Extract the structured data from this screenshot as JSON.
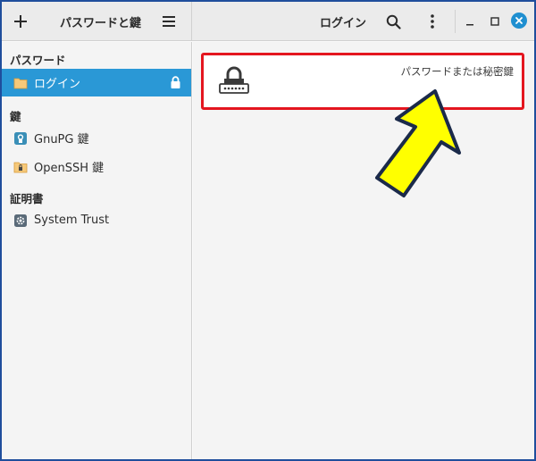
{
  "app": {
    "title": "パスワードと鍵"
  },
  "header": {
    "title": "ログイン",
    "add_icon": "plus-icon",
    "menu_icon": "hamburger-icon",
    "search_icon": "search-icon",
    "more_icon": "kebab-icon",
    "minimize_icon": "minimize-icon",
    "maximize_icon": "maximize-icon",
    "close_icon": "close-icon",
    "close_color": "#1f8fd0"
  },
  "sidebar": {
    "sections": [
      {
        "title": "パスワード"
      },
      {
        "title": "鍵"
      },
      {
        "title": "証明書"
      }
    ],
    "items": [
      {
        "label": "ログイン",
        "icon": "folder-icon",
        "selected": true,
        "locked": true
      },
      {
        "label": "GnuPG 鍵",
        "icon": "gnupg-key-icon"
      },
      {
        "label": "OpenSSH 鍵",
        "icon": "ssh-folder-icon"
      },
      {
        "label": "System Trust",
        "icon": "gear-icon"
      }
    ],
    "selected_color": "#2a98d6"
  },
  "main": {
    "items": [
      {
        "description": "パスワードまたは秘密鍵",
        "icon": "password-lock-icon"
      }
    ],
    "highlight_color": "#e4161f",
    "arrow_color": "#ffff00"
  }
}
